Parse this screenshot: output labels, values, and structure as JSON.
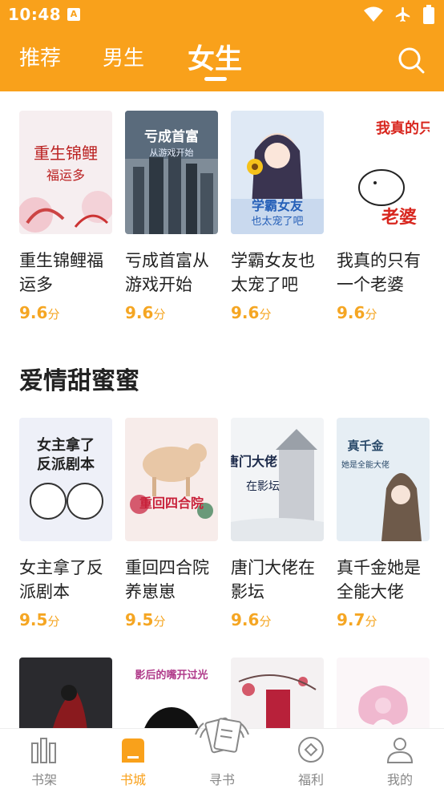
{
  "status": {
    "time": "10:48",
    "notif_letter": "A"
  },
  "tabs": {
    "recommend": "推荐",
    "male": "男生",
    "female": "女生"
  },
  "row1": [
    {
      "title": "重生锦鲤福运多",
      "score": "9.6",
      "unit": "分"
    },
    {
      "title": "亏成首富从游戏开始",
      "score": "9.6",
      "unit": "分"
    },
    {
      "title": "学霸女友也太宠了吧",
      "score": "9.6",
      "unit": "分"
    },
    {
      "title": "我真的只有一个老婆",
      "score": "9.6",
      "unit": "分"
    }
  ],
  "section": {
    "title": "爱情甜蜜蜜"
  },
  "row2": [
    {
      "title": "女主拿了反派剧本",
      "score": "9.5",
      "unit": "分"
    },
    {
      "title": "重回四合院养崽崽",
      "score": "9.5",
      "unit": "分"
    },
    {
      "title": "唐门大佬在影坛",
      "score": "9.6",
      "unit": "分"
    },
    {
      "title": "真千金她是全能大佬",
      "score": "9.7",
      "unit": "分"
    }
  ],
  "covers": {
    "c1": {
      "line1": "重生锦鲤",
      "line2": "福运多"
    },
    "c2": {
      "line1": "亏成首富",
      "line2": "从游戏开始"
    },
    "c3": {
      "line1": "学霸女友",
      "line2": "也太宠了吧"
    },
    "c4": {
      "line1": "我真的只有",
      "line2": "老婆"
    },
    "c5": {
      "line1": "女主拿了",
      "line2": "反派剧本"
    },
    "c6": {
      "line1": "重回四合院"
    },
    "c7": {
      "line1": "唐门大佬",
      "line2": "在影坛"
    },
    "c8": {
      "line1": "真千金",
      "line2": "她是全能大佬"
    },
    "c10": {
      "line1": "影后的嘴开过光"
    }
  },
  "nav": {
    "shelf": "书架",
    "store": "书城",
    "find": "寻书",
    "welfare": "福利",
    "mine": "我的"
  },
  "colors": {
    "accent": "#F9A11B",
    "score": "#F5A623"
  }
}
